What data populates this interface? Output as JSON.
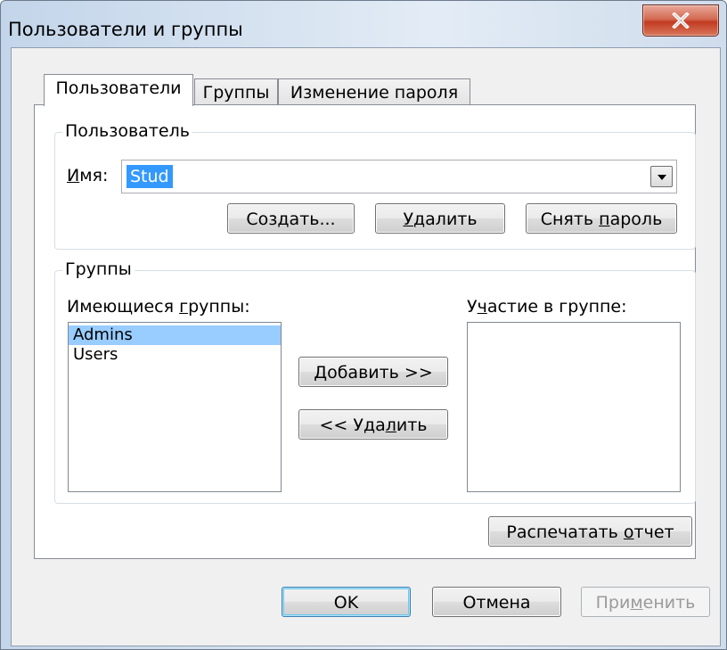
{
  "window": {
    "title": "Пользователи и группы",
    "close_symbol": "X"
  },
  "tabs": [
    {
      "label": "Пользователи",
      "active": true
    },
    {
      "label": "Группы",
      "active": false
    },
    {
      "label": "Изменение пароля",
      "active": false
    }
  ],
  "user_section": {
    "legend": "Пользователь",
    "name_label_u": "И",
    "name_label_rest": "мя:",
    "name_value": "Stud",
    "create_btn": {
      "pre": "Соз",
      "u": "д",
      "post": "ать..."
    },
    "delete_btn": {
      "pre": "",
      "u": "У",
      "post": "далить"
    },
    "clear_pwd_btn": {
      "pre": "Снять ",
      "u": "п",
      "post": "ароль"
    }
  },
  "groups_section": {
    "legend": "Группы",
    "available_label": {
      "pre": "Имеющиеся ",
      "u": "г",
      "post": "руппы:"
    },
    "available_items": [
      {
        "label": "Admins",
        "selected": true
      },
      {
        "label": "Users",
        "selected": false
      }
    ],
    "member_label": {
      "pre": "У",
      "u": "ч",
      "post": "астие в группе:"
    },
    "member_items": [],
    "add_btn": {
      "pre": "",
      "u": "Д",
      "post": "обавить >>"
    },
    "remove_btn": {
      "pre": "<< Уда",
      "u": "л",
      "post": "ить"
    }
  },
  "print_btn": {
    "pre": "Распечатать ",
    "u": "о",
    "post": "тчет"
  },
  "footer": {
    "ok": "OK",
    "cancel": "Отмена",
    "apply": {
      "pre": "При",
      "u": "м",
      "post": "енить"
    }
  },
  "colors": {
    "selection": "#3399ff",
    "list_selection": "#99ccff",
    "close_red": "#c23b22"
  }
}
